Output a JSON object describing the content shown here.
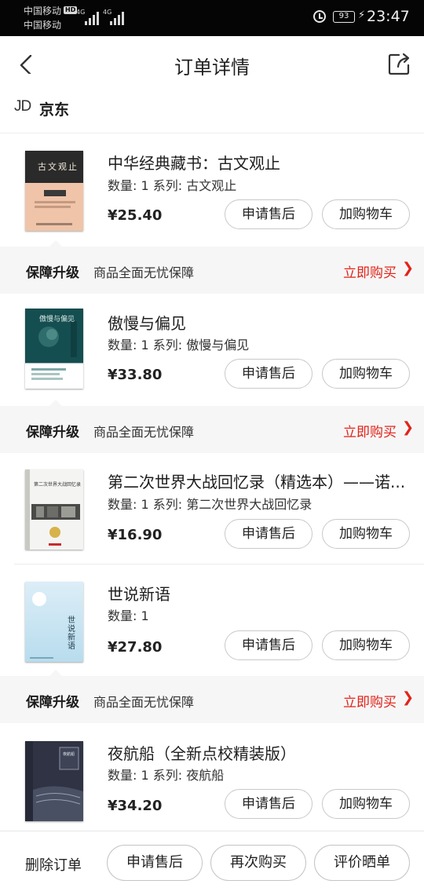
{
  "status_bar": {
    "carrier_1": "中国移动",
    "carrier_2": "中国移动",
    "hd_badge": "HD",
    "network_1": "4G",
    "network_2": "4G",
    "battery": "93",
    "time": "23:47",
    "icons": [
      "signal-icon",
      "alarm-icon",
      "battery-icon",
      "charging-icon"
    ]
  },
  "header": {
    "title": "订单详情",
    "back_icon": "chevron-left-icon",
    "share_icon": "share-icon"
  },
  "shop": {
    "logo": "JD",
    "name": "京东"
  },
  "labels": {
    "after_sale": "申请售后",
    "add_cart": "加购物车"
  },
  "guarantee": {
    "title": "保障升级",
    "desc": "商品全面无忧保障",
    "link": "立即购买",
    "chevron": "❯",
    "accent": "#e2231a"
  },
  "products": [
    {
      "title": "中华经典藏书：古文观止",
      "spec": "数量: 1 系列: 古文观止",
      "price": "¥25.40",
      "cover_text": "古文观止"
    },
    {
      "title": "傲慢与偏见",
      "spec": "数量: 1 系列: 傲慢与偏见",
      "price": "¥33.80",
      "cover_text": "傲慢与偏见"
    },
    {
      "title": "第二次世界大战回忆录（精选本）——诺...",
      "spec": "数量: 1 系列: 第二次世界大战回忆录",
      "price": "¥16.90",
      "cover_text": "第二次世界大战回忆录"
    },
    {
      "title": "世说新语",
      "spec": "数量: 1",
      "price": "¥27.80",
      "cover_text": "世说新语"
    },
    {
      "title": "夜航船（全新点校精装版）",
      "spec": "数量: 1 系列: 夜航船",
      "price": "¥34.20",
      "cover_text": "夜航船"
    }
  ],
  "bottom_bar": {
    "delete": "删除订单",
    "after_sale": "申请售后",
    "rebuy": "再次购买",
    "review": "评价晒单"
  }
}
